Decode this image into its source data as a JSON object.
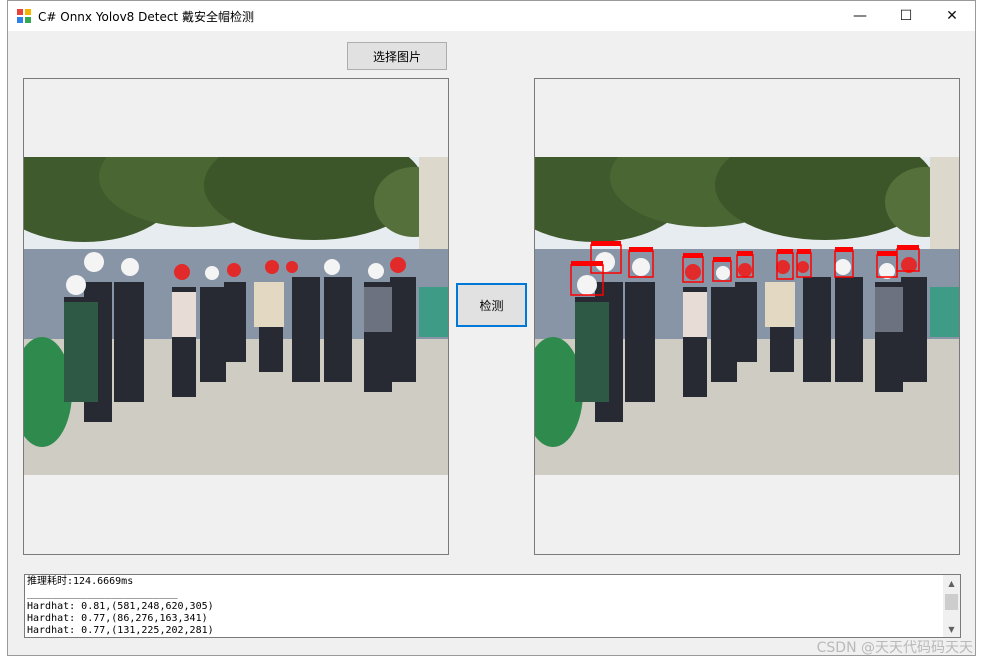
{
  "window": {
    "title": "C# Onnx Yolov8 Detect 戴安全帽检测",
    "minimize_glyph": "—",
    "maximize_glyph": "☐",
    "close_glyph": "✕"
  },
  "toolbar": {
    "select_image_label": "选择图片",
    "detect_label": "检测"
  },
  "images": {
    "input_icon": "construction-site-photo",
    "output_icon": "construction-site-photo-with-detections",
    "box_color": "#ff0000",
    "box_label": "hardhat"
  },
  "log": {
    "inference_time": "推理耗时:124.6669ms",
    "separator": "_________________________",
    "lines": [
      "Hardhat: 0.81,(581,248,620,305)",
      "Hardhat: 0.77,(86,276,163,341)",
      "Hardhat: 0.77,(131,225,202,281)"
    ]
  },
  "watermark": "CSDN @天天代码码天天"
}
